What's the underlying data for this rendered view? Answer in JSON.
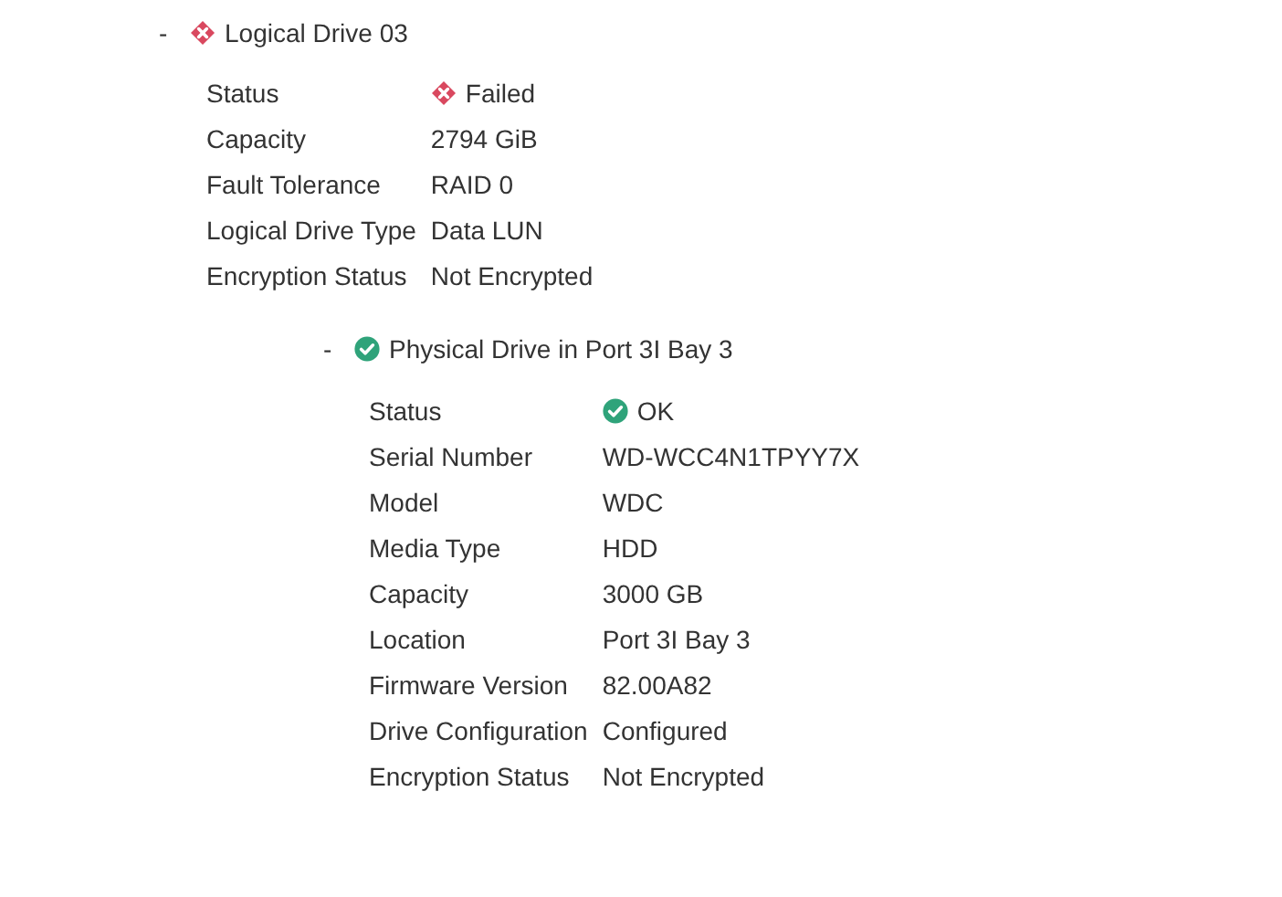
{
  "tree": [
    {
      "toggle": "-",
      "kind": "failed",
      "title": "Logical Drive 03",
      "properties": [
        {
          "label": "Status",
          "value": "Failed",
          "kind": "failed"
        },
        {
          "label": "Capacity",
          "value": "2794 GiB"
        },
        {
          "label": "Fault Tolerance",
          "value": "RAID 0"
        },
        {
          "label": "Logical Drive Type",
          "value": "Data LUN"
        },
        {
          "label": "Encryption Status",
          "value": "Not Encrypted"
        }
      ],
      "children": [
        {
          "toggle": "-",
          "kind": "ok",
          "title": "Physical Drive in Port 3I Bay 3",
          "properties": [
            {
              "label": "Status",
              "value": "OK",
              "kind": "ok"
            },
            {
              "label": "Serial Number",
              "value": "WD-WCC4N1TPYY7X"
            },
            {
              "label": "Model",
              "value": "WDC"
            },
            {
              "label": "Media Type",
              "value": "HDD"
            },
            {
              "label": "Capacity",
              "value": "3000 GB"
            },
            {
              "label": "Location",
              "value": "Port 3I Bay 3"
            },
            {
              "label": "Firmware Version",
              "value": "82.00A82"
            },
            {
              "label": "Drive Configuration",
              "value": "Configured"
            },
            {
              "label": "Encryption Status",
              "value": "Not Encrypted"
            }
          ]
        }
      ]
    }
  ]
}
